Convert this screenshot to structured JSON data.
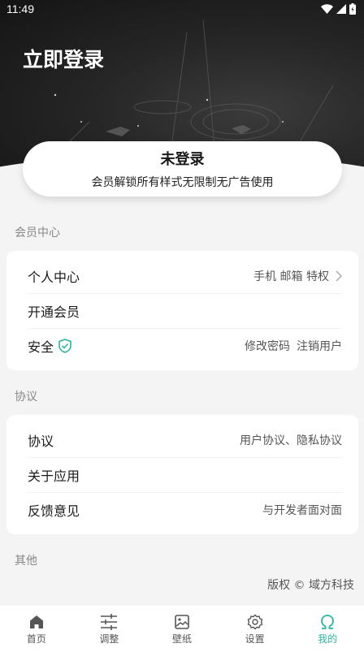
{
  "status_bar": {
    "time": "11:49"
  },
  "header": {
    "title": "立即登录"
  },
  "login_card": {
    "title": "未登录",
    "subtitle": "会员解锁所有样式无限制无广告使用"
  },
  "member_section": {
    "label": "会员中心",
    "rows": [
      {
        "label": "个人中心",
        "right": "手机 邮箱 特权"
      },
      {
        "label": "开通会员",
        "right": ""
      },
      {
        "label": "安全",
        "right_1": "修改密码",
        "right_2": "注销用户"
      }
    ]
  },
  "agreement_section": {
    "label": "协议",
    "rows": [
      {
        "label": "协议",
        "right": "用户协议、隐私协议"
      },
      {
        "label": "关于应用",
        "right": ""
      },
      {
        "label": "反馈意见",
        "right": "与开发者面对面"
      }
    ]
  },
  "other_section": {
    "label": "其他",
    "copyright": "版权 © 域方科技"
  },
  "tabbar": {
    "tabs": [
      {
        "label": "首页",
        "icon": "home-icon",
        "active": false
      },
      {
        "label": "调整",
        "icon": "sliders-icon",
        "active": false
      },
      {
        "label": "壁纸",
        "icon": "image-icon",
        "active": false
      },
      {
        "label": "设置",
        "icon": "gear-icon",
        "active": false
      },
      {
        "label": "我的",
        "icon": "omega-icon",
        "active": true
      }
    ]
  },
  "colors": {
    "accent": "#2ab5a0",
    "hero_dark": "#1f1f1f",
    "background": "#f4f4f4"
  }
}
